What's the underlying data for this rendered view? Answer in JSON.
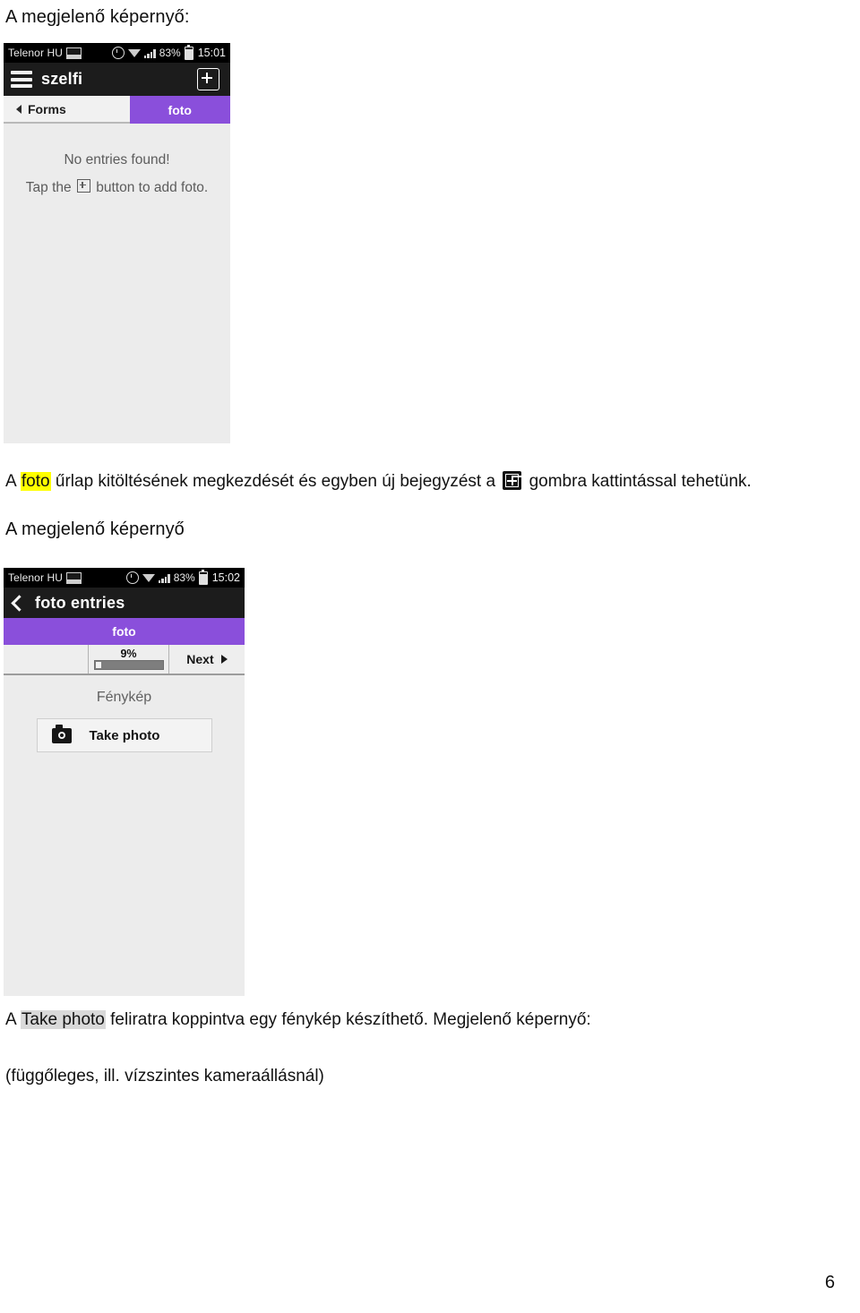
{
  "document": {
    "heading1": "A megjelenő képernyő:",
    "heading2": "A megjelenő képernyő",
    "para1": {
      "before": "A ",
      "highlight": "foto",
      "middle": " űrlap kitöltésének megkezdését és egyben új bejegyzést a ",
      "icon": "plus-box-icon",
      "after": " gombra kattintással tehetünk."
    },
    "para2": {
      "before": "A ",
      "highlight": "Take photo",
      "after": " feliratra koppintva egy fénykép készíthető. Megjelenő képernyő:"
    },
    "para3": "(függőleges, ill. vízszintes kameraállásnál)",
    "page_number": "6"
  },
  "screenshot1": {
    "statusbar": {
      "carrier": "Telenor HU",
      "battery_pct": "83%",
      "clock": "15:01"
    },
    "actionbar": {
      "title": "szelfi",
      "menu_icon": "hamburger-icon",
      "add_icon": "plus-box-icon"
    },
    "tabs": [
      {
        "label": "Forms",
        "active": false
      },
      {
        "label": "foto",
        "active": true
      }
    ],
    "empty_state": {
      "line1": "No entries found!",
      "line2_before": "Tap the ",
      "line2_after": " button to add foto."
    }
  },
  "screenshot2": {
    "statusbar": {
      "carrier": "Telenor HU",
      "battery_pct": "83%",
      "clock": "15:02"
    },
    "actionbar": {
      "title": "foto entries",
      "back_icon": "back-chevron-icon"
    },
    "form_tab": "foto",
    "nav": {
      "prev_label": "",
      "progress_pct": "9%",
      "progress_value": 9,
      "next_label": "Next"
    },
    "field": {
      "label": "Fénykép",
      "button_label": "Take photo",
      "button_icon": "camera-icon"
    }
  },
  "colors": {
    "purple_accent": "#8A4FDB",
    "highlight_yellow": "#FFFF00",
    "highlight_grey": "#D9D9D9",
    "screen_bg": "#ECECEC",
    "actionbar_bg": "#1C1C1C"
  }
}
